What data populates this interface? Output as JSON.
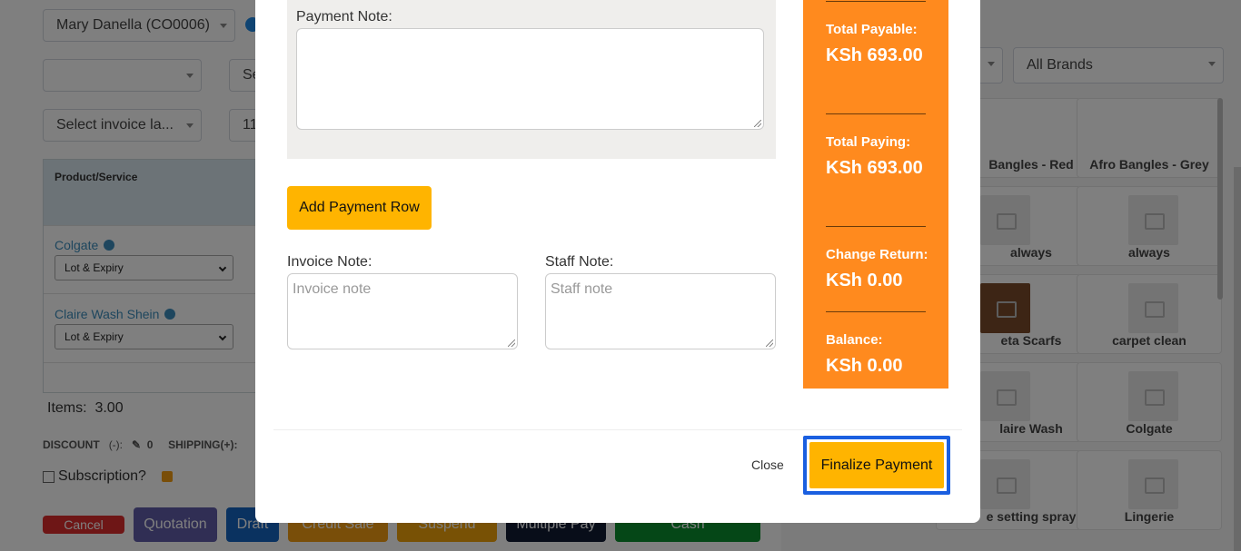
{
  "background": {
    "customer_select": "Mary Danella (CO0006)",
    "invoice_layout_select": "Select invoice la...",
    "search_select_partial": "Se",
    "date_partial": "11/",
    "table": {
      "header_product": "Product/Service",
      "rows": [
        {
          "name": "Colgate",
          "lot": "Lot & Expiry"
        },
        {
          "name": "Claire Wash Shein",
          "lot": "Lot & Expiry"
        }
      ]
    },
    "items_label": "Items:",
    "items_value": "3.00",
    "discount_label": "DISCOUNT",
    "discount_sign": "(-):",
    "discount_value": "0",
    "shipping_label": "SHIPPING(+):",
    "subscription_label": "Subscription?",
    "buttons": {
      "cancel": "Cancel",
      "quotation": "Quotation",
      "draft": "Draft",
      "credit_sale": "Credit Sale",
      "suspend": "Suspend",
      "multiple_pay": "Multiple Pay",
      "cash": "Cash"
    },
    "brand_select": "All Brands",
    "tiles": [
      "Bangles - Red",
      "Afro Bangles - Grey",
      "always",
      "always",
      "eta Scarfs",
      "carpet clean",
      "laire Wash",
      "Colgate",
      "e setting spray",
      "Lingerie"
    ]
  },
  "modal": {
    "payment_note_label": "Payment Note:",
    "payment_note_value": "",
    "add_payment_row": "Add Payment Row",
    "invoice_note_label": "Invoice Note:",
    "invoice_note_placeholder": "Invoice note",
    "staff_note_label": "Staff Note:",
    "staff_note_placeholder": "Staff note",
    "summary": {
      "total_payable_label": "Total Payable:",
      "total_payable_value": "KSh 693.00",
      "total_paying_label": "Total Paying:",
      "total_paying_value": "KSh 693.00",
      "change_return_label": "Change Return:",
      "change_return_value": "KSh 0.00",
      "balance_label": "Balance:",
      "balance_value": "KSh 0.00"
    },
    "close": "Close",
    "finalize": "Finalize Payment"
  },
  "colors": {
    "summary_bg": "#ff8a1e",
    "accent_button": "#ffb400",
    "focus_ring": "#1a5fe0",
    "overlay": "rgba(0,0,0,0.5)"
  }
}
